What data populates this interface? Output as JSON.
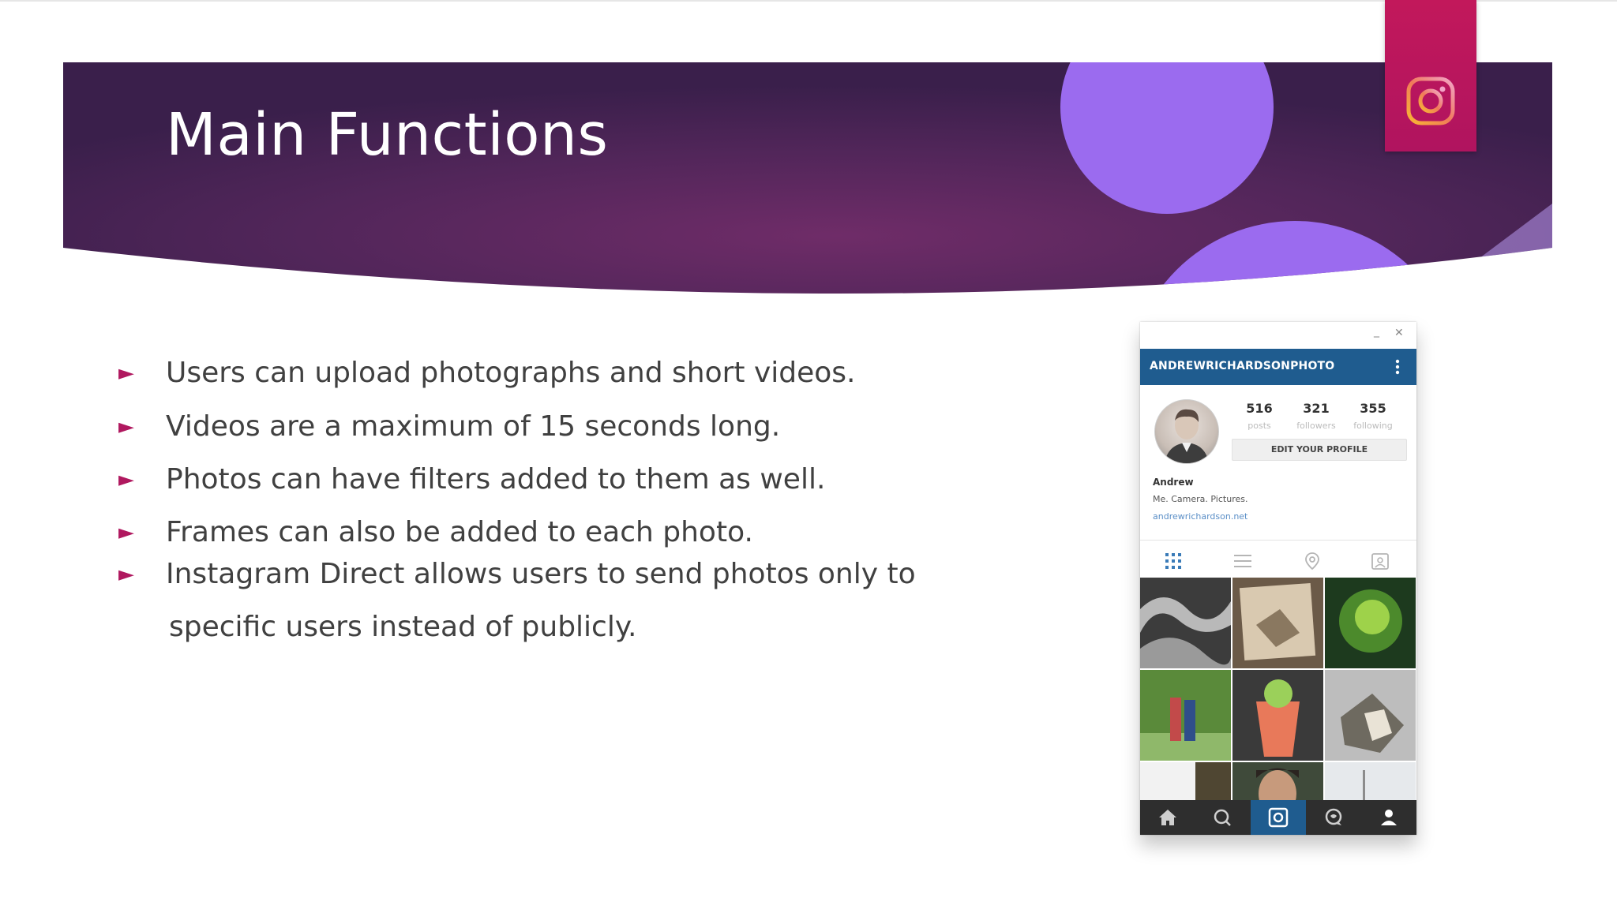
{
  "slide": {
    "title": "Main Functions",
    "bullets": [
      "Users can upload photographs and short videos.",
      "Videos are a maximum of 15 seconds long.",
      "Photos can have filters added to them as well.",
      "Frames can also be added to each photo.",
      "Instagram Direct allows users to send photos only to"
    ],
    "bullet_continuation": "specific users instead of publicly.",
    "bullet_marker": "►"
  },
  "icons": {
    "tab_icon": "instagram-icon"
  },
  "phone": {
    "window_minimize": "_",
    "window_close": "✕",
    "username": "ANDREWRICHARDSONPHOTO",
    "stats": [
      {
        "num": "516",
        "label": "posts"
      },
      {
        "num": "321",
        "label": "followers"
      },
      {
        "num": "355",
        "label": "following"
      }
    ],
    "edit_profile": "EDIT YOUR PROFILE",
    "bio_name": "Andrew",
    "bio_line": "Me. Camera. Pictures.",
    "bio_link": "andrewrichardson.net"
  },
  "colors": {
    "banner_dark": "#3b1f4c",
    "banner_mid": "#6b2c63",
    "circle": "#9b6bef",
    "tab_magenta": "#c2185b",
    "bullet": "#b0185f",
    "phone_header": "#1f5c8f"
  }
}
